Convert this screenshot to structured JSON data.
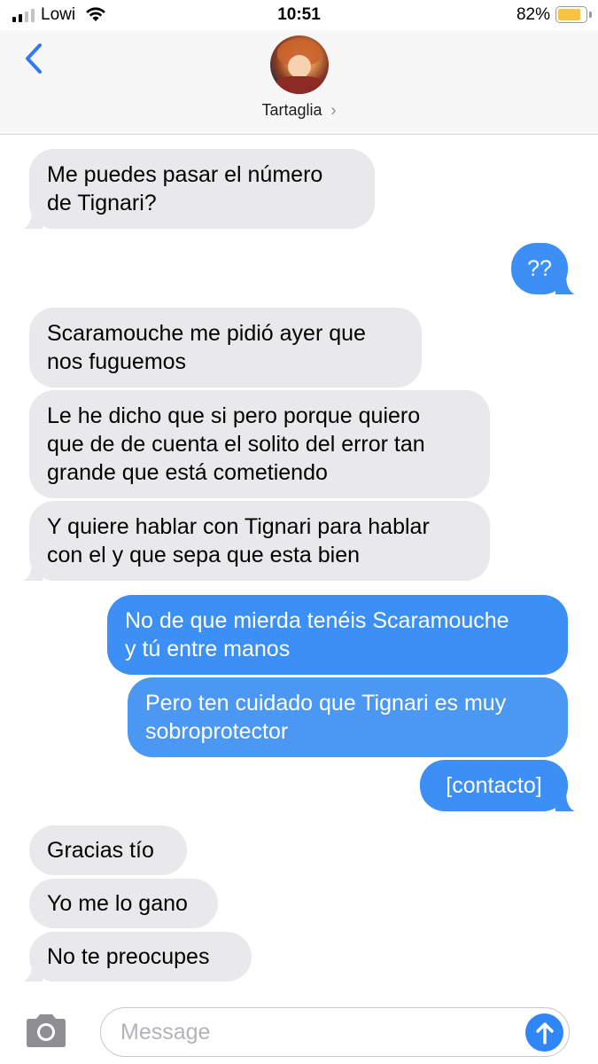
{
  "status_bar": {
    "carrier": "Lowi",
    "time": "10:51",
    "battery_percent": "82%",
    "battery_level": 0.82,
    "battery_color": "#f6c343"
  },
  "header": {
    "back_icon": "chevron-left-icon",
    "contact_name": "Tartaglia",
    "chevron": "›"
  },
  "messages": [
    {
      "side": "received",
      "lines": [
        "Me puedes pasar el número",
        "de Tignari?"
      ]
    },
    {
      "side": "sent",
      "lines": [
        "??"
      ]
    },
    {
      "side": "received",
      "lines": [
        "Scaramouche me pidió ayer que",
        "nos fuguemos"
      ]
    },
    {
      "side": "received",
      "lines": [
        "Le he dicho que si pero porque quiero",
        "que de de cuenta el solito del error tan",
        "grande que está cometiendo"
      ]
    },
    {
      "side": "received",
      "lines": [
        "Y quiere hablar con Tignari para hablar",
        "con el y que sepa que esta bien"
      ]
    },
    {
      "side": "sent",
      "lines": [
        "No de que mierda tenéis Scaramouche",
        "y tú entre manos"
      ]
    },
    {
      "side": "sent",
      "lines": [
        "Pero ten cuidado que Tignari es muy",
        "sobroprotector"
      ]
    },
    {
      "side": "sent",
      "lines": [
        "[contacto]"
      ]
    },
    {
      "side": "received",
      "lines": [
        "Gracias tío"
      ]
    },
    {
      "side": "received",
      "lines": [
        "Yo me lo gano"
      ]
    },
    {
      "side": "received",
      "lines": [
        "No te preocupes"
      ]
    }
  ],
  "composer": {
    "placeholder": "Message",
    "camera_icon": "camera-icon",
    "send_icon": "send-arrow-icon"
  },
  "colors": {
    "sent_bubble": "#3c8ff5",
    "received_bubble": "#e9e9eb",
    "accent": "#2f86f6"
  }
}
